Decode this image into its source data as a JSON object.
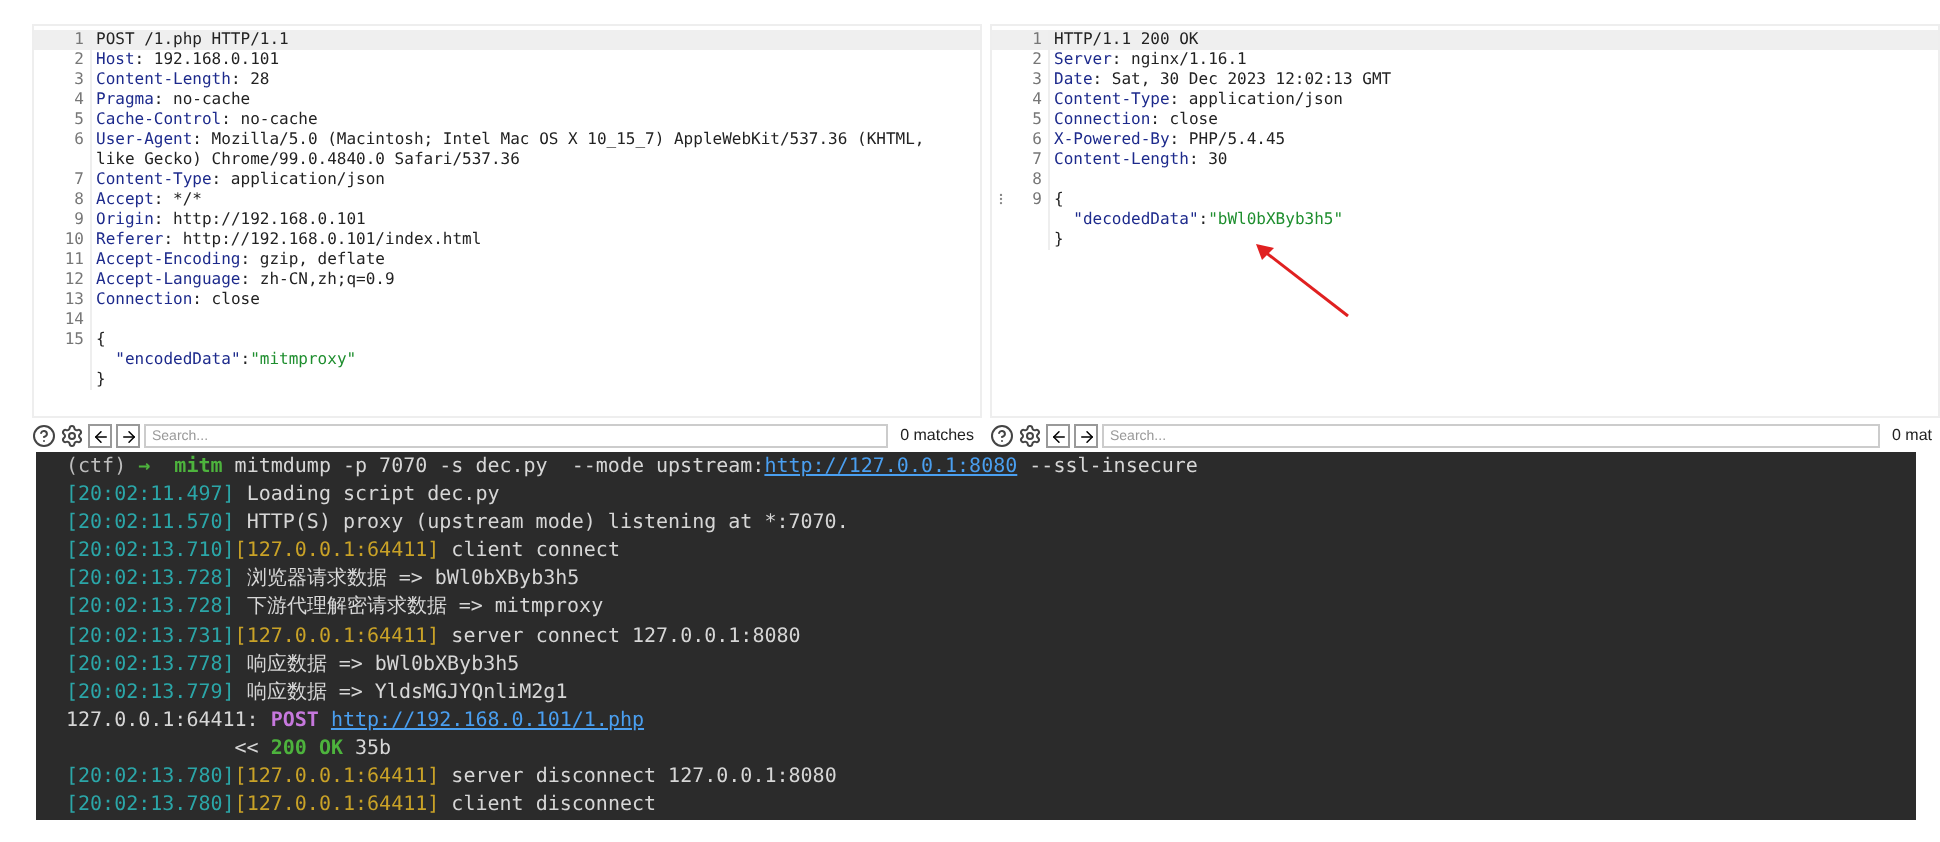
{
  "panels": [
    {
      "lines": [
        {
          "num": "1",
          "selected": true,
          "segments": [
            {
              "kind": "plain",
              "text": "POST /1.php HTTP/1.1"
            }
          ]
        },
        {
          "num": "2",
          "selected": false,
          "segments": [
            {
              "kind": "header",
              "text": "Host"
            },
            {
              "kind": "plain",
              "text": ": 192.168.0.101"
            }
          ]
        },
        {
          "num": "3",
          "selected": false,
          "segments": [
            {
              "kind": "header",
              "text": "Content-Length"
            },
            {
              "kind": "plain",
              "text": ": 28"
            }
          ]
        },
        {
          "num": "4",
          "selected": false,
          "segments": [
            {
              "kind": "header",
              "text": "Pragma"
            },
            {
              "kind": "plain",
              "text": ": no-cache"
            }
          ]
        },
        {
          "num": "5",
          "selected": false,
          "segments": [
            {
              "kind": "header",
              "text": "Cache-Control"
            },
            {
              "kind": "plain",
              "text": ": no-cache"
            }
          ]
        },
        {
          "num": "6",
          "selected": false,
          "segments": [
            {
              "kind": "header",
              "text": "User-Agent"
            },
            {
              "kind": "plain",
              "text": ": Mozilla/5.0 (Macintosh; Intel Mac OS X 10_15_7) AppleWebKit/537.36 (KHTML, like Gecko) Chrome/99.0.4840.0 Safari/537.36"
            }
          ]
        },
        {
          "num": "7",
          "selected": false,
          "segments": [
            {
              "kind": "header",
              "text": "Content-Type"
            },
            {
              "kind": "plain",
              "text": ": application/json"
            }
          ]
        },
        {
          "num": "8",
          "selected": false,
          "segments": [
            {
              "kind": "header",
              "text": "Accept"
            },
            {
              "kind": "plain",
              "text": ": */*"
            }
          ]
        },
        {
          "num": "9",
          "selected": false,
          "segments": [
            {
              "kind": "header",
              "text": "Origin"
            },
            {
              "kind": "plain",
              "text": ": http://192.168.0.101"
            }
          ]
        },
        {
          "num": "10",
          "selected": false,
          "segments": [
            {
              "kind": "header",
              "text": "Referer"
            },
            {
              "kind": "plain",
              "text": ": http://192.168.0.101/index.html"
            }
          ]
        },
        {
          "num": "11",
          "selected": false,
          "segments": [
            {
              "kind": "header",
              "text": "Accept-Encoding"
            },
            {
              "kind": "plain",
              "text": ": gzip, deflate"
            }
          ]
        },
        {
          "num": "12",
          "selected": false,
          "segments": [
            {
              "kind": "header",
              "text": "Accept-Language"
            },
            {
              "kind": "plain",
              "text": ": zh-CN,zh;q=0.9"
            }
          ]
        },
        {
          "num": "13",
          "selected": false,
          "segments": [
            {
              "kind": "header",
              "text": "Connection"
            },
            {
              "kind": "plain",
              "text": ": close"
            }
          ]
        },
        {
          "num": "14",
          "selected": false
        },
        {
          "num": "15",
          "selected": false,
          "segments": [
            {
              "kind": "plain",
              "text": "{"
            }
          ]
        },
        {
          "selected": false,
          "segments": [
            {
              "kind": "key",
              "text": "  \"encodedData\""
            },
            {
              "kind": "plain",
              "text": ":"
            },
            {
              "kind": "string",
              "text": "\"mitmproxy\""
            }
          ]
        },
        {
          "selected": false,
          "segments": [
            {
              "kind": "plain",
              "text": "}"
            }
          ]
        }
      ],
      "search": {
        "placeholder": "Search...",
        "matches": "0 matches"
      }
    },
    {
      "lines": [
        {
          "num": "1",
          "selected": true,
          "segments": [
            {
              "kind": "plain",
              "text": "HTTP/1.1 200 OK"
            }
          ]
        },
        {
          "num": "2",
          "selected": false,
          "segments": [
            {
              "kind": "header",
              "text": "Server"
            },
            {
              "kind": "plain",
              "text": ": nginx/1.16.1"
            }
          ]
        },
        {
          "num": "3",
          "selected": false,
          "segments": [
            {
              "kind": "header",
              "text": "Date"
            },
            {
              "kind": "plain",
              "text": ": Sat, 30 Dec 2023 12:02:13 GMT"
            }
          ]
        },
        {
          "num": "4",
          "selected": false,
          "segments": [
            {
              "kind": "header",
              "text": "Content-Type"
            },
            {
              "kind": "plain",
              "text": ": application/json"
            }
          ]
        },
        {
          "num": "5",
          "selected": false,
          "segments": [
            {
              "kind": "header",
              "text": "Connection"
            },
            {
              "kind": "plain",
              "text": ": close"
            }
          ]
        },
        {
          "num": "6",
          "selected": false,
          "segments": [
            {
              "kind": "header",
              "text": "X-Powered-By"
            },
            {
              "kind": "plain",
              "text": ": PHP/5.4.45"
            }
          ]
        },
        {
          "num": "7",
          "selected": false,
          "segments": [
            {
              "kind": "header",
              "text": "Content-Length"
            },
            {
              "kind": "plain",
              "text": ": 30"
            }
          ]
        },
        {
          "num": "8",
          "selected": false
        },
        {
          "num": "9",
          "selected": false,
          "marker": true,
          "segments": [
            {
              "kind": "plain",
              "text": "{"
            }
          ]
        },
        {
          "selected": false,
          "segments": [
            {
              "kind": "key",
              "text": "  \"decodedData\""
            },
            {
              "kind": "plain",
              "text": ":"
            },
            {
              "kind": "string",
              "text": "\"bWl0bXByb3h5\""
            }
          ]
        },
        {
          "selected": false,
          "segments": [
            {
              "kind": "plain",
              "text": "}"
            }
          ]
        }
      ],
      "search": {
        "placeholder": "Search...",
        "matches": "0 mat"
      }
    }
  ],
  "terminal": {
    "lines": [
      {
        "segments": [
          {
            "kind": "prompt",
            "text": "(ctf) "
          },
          {
            "kind": "ok",
            "text": "→  mitm "
          },
          {
            "kind": "text",
            "text": "mitmdump -p 7070 -s dec.py  --mode upstream:"
          },
          {
            "kind": "link",
            "text": "http://127.0.0.1:8080"
          },
          {
            "kind": "text",
            "text": " --ssl-insecure"
          }
        ]
      },
      {
        "segments": [
          {
            "kind": "time",
            "text": "[20:02:11.497]"
          },
          {
            "kind": "text",
            "text": " Loading script dec.py"
          }
        ]
      },
      {
        "segments": [
          {
            "kind": "time",
            "text": "[20:02:11.570]"
          },
          {
            "kind": "text",
            "text": " HTTP(S) proxy (upstream mode) listening at *:7070."
          }
        ]
      },
      {
        "segments": [
          {
            "kind": "time",
            "text": "[20:02:13.710]"
          },
          {
            "kind": "addr",
            "text": "[127.0.0.1:64411]"
          },
          {
            "kind": "text",
            "text": " client connect"
          }
        ]
      },
      {
        "segments": [
          {
            "kind": "time",
            "text": "[20:02:13.728]"
          },
          {
            "kind": "text",
            "text": " 浏览器请求数据 => bWl0bXByb3h5"
          }
        ]
      },
      {
        "segments": [
          {
            "kind": "time",
            "text": "[20:02:13.728]"
          },
          {
            "kind": "text",
            "text": " 下游代理解密请求数据 => mitmproxy"
          }
        ]
      },
      {
        "segments": [
          {
            "kind": "time",
            "text": "[20:02:13.731]"
          },
          {
            "kind": "addr",
            "text": "[127.0.0.1:64411]"
          },
          {
            "kind": "text",
            "text": " server connect 127.0.0.1:8080"
          }
        ]
      },
      {
        "segments": [
          {
            "kind": "time",
            "text": "[20:02:13.778]"
          },
          {
            "kind": "text",
            "text": " 响应数据 => bWl0bXByb3h5"
          }
        ]
      },
      {
        "segments": [
          {
            "kind": "time",
            "text": "[20:02:13.779]"
          },
          {
            "kind": "text",
            "text": " 响应数据 => YldsMGJYQnliM2g1"
          }
        ]
      },
      {
        "segments": [
          {
            "kind": "text",
            "text": "127.0.0.1:64411: "
          },
          {
            "kind": "method",
            "text": "POST "
          },
          {
            "kind": "link",
            "text": "http://192.168.0.101/1.php"
          }
        ]
      },
      {
        "segments": [
          {
            "kind": "text",
            "text": "              << "
          },
          {
            "kind": "ok",
            "text": "200 OK"
          },
          {
            "kind": "text",
            "text": " 35b"
          }
        ]
      },
      {
        "segments": [
          {
            "kind": "time",
            "text": "[20:02:13.780]"
          },
          {
            "kind": "addr",
            "text": "[127.0.0.1:64411]"
          },
          {
            "kind": "text",
            "text": " server disconnect 127.0.0.1:8080"
          }
        ]
      },
      {
        "segments": [
          {
            "kind": "time",
            "text": "[20:02:13.780]"
          },
          {
            "kind": "addr",
            "text": "[127.0.0.1:64411]"
          },
          {
            "kind": "text",
            "text": " client disconnect"
          }
        ]
      }
    ]
  }
}
